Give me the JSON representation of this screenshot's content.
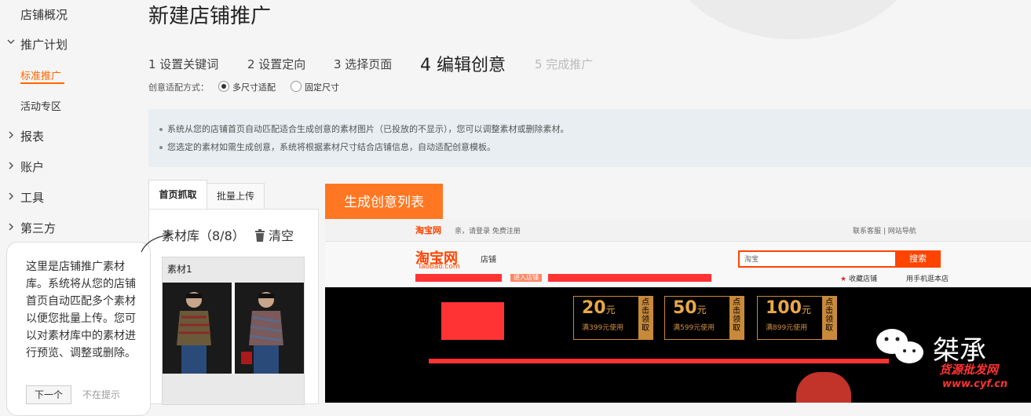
{
  "sidebar": {
    "items": [
      {
        "label": "店铺概况"
      },
      {
        "label": "推广计划",
        "expanded": true
      },
      {
        "label": "标准推广",
        "active": true
      },
      {
        "label": "活动专区"
      },
      {
        "label": "报表"
      },
      {
        "label": "账户"
      },
      {
        "label": "工具"
      },
      {
        "label": "第三方"
      }
    ]
  },
  "page": {
    "title": "新建店铺推广"
  },
  "steps": [
    {
      "label": "1 设置关键词"
    },
    {
      "label": "2 设置定向"
    },
    {
      "label": "3 选择页面"
    },
    {
      "label": "4 编辑创意",
      "active": true
    },
    {
      "label": "5 完成推广",
      "disabled": true
    }
  ],
  "mode": {
    "label": "创意适配方式：",
    "options": [
      "多尺寸适配",
      "固定尺寸"
    ],
    "selected": "多尺寸适配"
  },
  "info": {
    "lines": [
      "系统从您的店铺首页自动匹配适合生成创意的素材图片（已投放的不显示），您可以调整素材或删除素材。",
      "您选定的素材如需生成创意，系统将根据素材尺寸结合店铺信息，自动适配创意模板。"
    ]
  },
  "tabs": [
    {
      "label": "首页抓取",
      "active": true
    },
    {
      "label": "批量上传"
    }
  ],
  "library": {
    "title": "素材库（8/8）",
    "clear_label": "清空",
    "items": [
      {
        "label": "素材1"
      }
    ]
  },
  "generate_button": "生成创意列表",
  "preview": {
    "top_left": "亲，请登录  免费注册",
    "top_right": "联系客服  |  网站导航",
    "logo": "淘宝网",
    "logo_sub": "Taobao.com",
    "shop": "店铺",
    "search_scope": "淘宝",
    "search_button": "搜索",
    "nav_tag": "进入店铺",
    "fav": "收藏店铺",
    "mobile": "用手机逛本店",
    "coupons": [
      {
        "value": "20",
        "unit": "元",
        "condition": "满399元使用",
        "side": "点击领取"
      },
      {
        "value": "50",
        "unit": "元",
        "condition": "满599元使用",
        "side": "点击领取"
      },
      {
        "value": "100",
        "unit": "元",
        "condition": "满899元使用",
        "side": "点击领取"
      }
    ],
    "colors": {
      "accent": "#ff4400",
      "redacted": "#ff3333"
    }
  },
  "tooltip": {
    "text": "这里是店铺推广素材库。系统将从您的店铺首页自动匹配多个素材以便您批量上传。您可以对素材库中的素材进行预览、调整或删除。",
    "next_label": "下一个",
    "skip_label": "不在提示"
  },
  "watermark": {
    "text": "桀承",
    "sub": "货源批发网",
    "url": "www.cyf.cn"
  },
  "colors": {
    "accent": "#ff6600",
    "button": "#ff7722",
    "info_bg": "#e8eef2"
  }
}
